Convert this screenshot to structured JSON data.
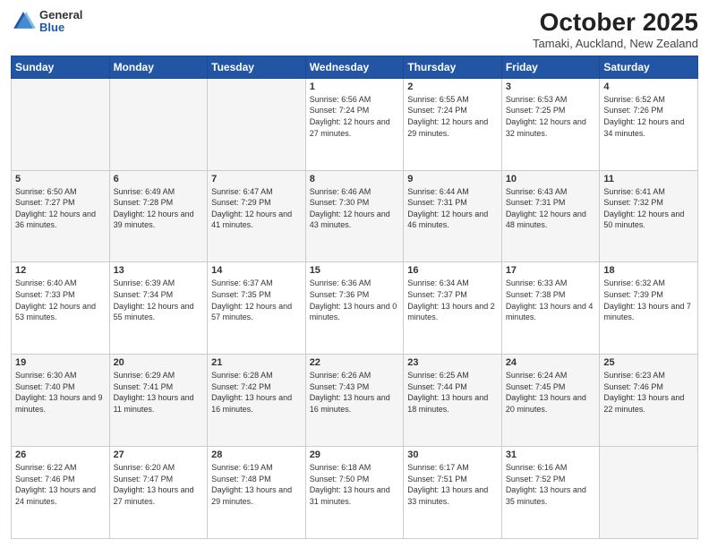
{
  "header": {
    "logo_general": "General",
    "logo_blue": "Blue",
    "month_title": "October 2025",
    "location": "Tamaki, Auckland, New Zealand"
  },
  "weekdays": [
    "Sunday",
    "Monday",
    "Tuesday",
    "Wednesday",
    "Thursday",
    "Friday",
    "Saturday"
  ],
  "weeks": [
    [
      null,
      null,
      null,
      {
        "day": "1",
        "sunrise": "6:56 AM",
        "sunset": "7:24 PM",
        "daylight": "12 hours and 27 minutes."
      },
      {
        "day": "2",
        "sunrise": "6:55 AM",
        "sunset": "7:24 PM",
        "daylight": "12 hours and 29 minutes."
      },
      {
        "day": "3",
        "sunrise": "6:53 AM",
        "sunset": "7:25 PM",
        "daylight": "12 hours and 32 minutes."
      },
      {
        "day": "4",
        "sunrise": "6:52 AM",
        "sunset": "7:26 PM",
        "daylight": "12 hours and 34 minutes."
      }
    ],
    [
      {
        "day": "5",
        "sunrise": "6:50 AM",
        "sunset": "7:27 PM",
        "daylight": "12 hours and 36 minutes."
      },
      {
        "day": "6",
        "sunrise": "6:49 AM",
        "sunset": "7:28 PM",
        "daylight": "12 hours and 39 minutes."
      },
      {
        "day": "7",
        "sunrise": "6:47 AM",
        "sunset": "7:29 PM",
        "daylight": "12 hours and 41 minutes."
      },
      {
        "day": "8",
        "sunrise": "6:46 AM",
        "sunset": "7:30 PM",
        "daylight": "12 hours and 43 minutes."
      },
      {
        "day": "9",
        "sunrise": "6:44 AM",
        "sunset": "7:31 PM",
        "daylight": "12 hours and 46 minutes."
      },
      {
        "day": "10",
        "sunrise": "6:43 AM",
        "sunset": "7:31 PM",
        "daylight": "12 hours and 48 minutes."
      },
      {
        "day": "11",
        "sunrise": "6:41 AM",
        "sunset": "7:32 PM",
        "daylight": "12 hours and 50 minutes."
      }
    ],
    [
      {
        "day": "12",
        "sunrise": "6:40 AM",
        "sunset": "7:33 PM",
        "daylight": "12 hours and 53 minutes."
      },
      {
        "day": "13",
        "sunrise": "6:39 AM",
        "sunset": "7:34 PM",
        "daylight": "12 hours and 55 minutes."
      },
      {
        "day": "14",
        "sunrise": "6:37 AM",
        "sunset": "7:35 PM",
        "daylight": "12 hours and 57 minutes."
      },
      {
        "day": "15",
        "sunrise": "6:36 AM",
        "sunset": "7:36 PM",
        "daylight": "13 hours and 0 minutes."
      },
      {
        "day": "16",
        "sunrise": "6:34 AM",
        "sunset": "7:37 PM",
        "daylight": "13 hours and 2 minutes."
      },
      {
        "day": "17",
        "sunrise": "6:33 AM",
        "sunset": "7:38 PM",
        "daylight": "13 hours and 4 minutes."
      },
      {
        "day": "18",
        "sunrise": "6:32 AM",
        "sunset": "7:39 PM",
        "daylight": "13 hours and 7 minutes."
      }
    ],
    [
      {
        "day": "19",
        "sunrise": "6:30 AM",
        "sunset": "7:40 PM",
        "daylight": "13 hours and 9 minutes."
      },
      {
        "day": "20",
        "sunrise": "6:29 AM",
        "sunset": "7:41 PM",
        "daylight": "13 hours and 11 minutes."
      },
      {
        "day": "21",
        "sunrise": "6:28 AM",
        "sunset": "7:42 PM",
        "daylight": "13 hours and 16 minutes."
      },
      {
        "day": "22",
        "sunrise": "6:26 AM",
        "sunset": "7:43 PM",
        "daylight": "13 hours and 16 minutes."
      },
      {
        "day": "23",
        "sunrise": "6:25 AM",
        "sunset": "7:44 PM",
        "daylight": "13 hours and 18 minutes."
      },
      {
        "day": "24",
        "sunrise": "6:24 AM",
        "sunset": "7:45 PM",
        "daylight": "13 hours and 20 minutes."
      },
      {
        "day": "25",
        "sunrise": "6:23 AM",
        "sunset": "7:46 PM",
        "daylight": "13 hours and 22 minutes."
      }
    ],
    [
      {
        "day": "26",
        "sunrise": "6:22 AM",
        "sunset": "7:46 PM",
        "daylight": "13 hours and 24 minutes."
      },
      {
        "day": "27",
        "sunrise": "6:20 AM",
        "sunset": "7:47 PM",
        "daylight": "13 hours and 27 minutes."
      },
      {
        "day": "28",
        "sunrise": "6:19 AM",
        "sunset": "7:48 PM",
        "daylight": "13 hours and 29 minutes."
      },
      {
        "day": "29",
        "sunrise": "6:18 AM",
        "sunset": "7:50 PM",
        "daylight": "13 hours and 31 minutes."
      },
      {
        "day": "30",
        "sunrise": "6:17 AM",
        "sunset": "7:51 PM",
        "daylight": "13 hours and 33 minutes."
      },
      {
        "day": "31",
        "sunrise": "6:16 AM",
        "sunset": "7:52 PM",
        "daylight": "13 hours and 35 minutes."
      },
      null
    ]
  ]
}
